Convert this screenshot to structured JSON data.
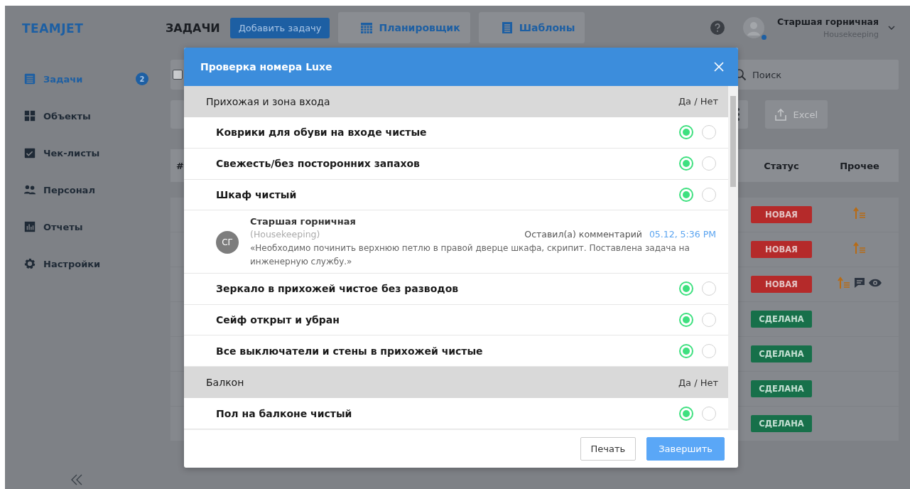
{
  "app": {
    "logo": "TEAMJET",
    "page_title": "ЗАДАЧИ",
    "actions": [
      {
        "label": "Добавить задачу",
        "kind": "primary"
      },
      {
        "label": "Планировщик",
        "kind": "planner"
      },
      {
        "label": "Шаблоны",
        "kind": "templates"
      }
    ],
    "user": {
      "name": "Старшая горничная",
      "role": "Housekeeping",
      "online": true
    }
  },
  "sidebar": {
    "items": [
      {
        "label": "Задачи",
        "selected": true,
        "badge": "2"
      },
      {
        "label": "Объекты",
        "selected": false
      },
      {
        "label": "Чек-листы",
        "selected": false
      },
      {
        "label": "Персонал",
        "selected": false
      },
      {
        "label": "Отчеты",
        "selected": false
      },
      {
        "label": "Настройки",
        "selected": false
      }
    ]
  },
  "toolbar": {
    "select_all": {
      "checked": false
    },
    "search": {
      "placeholder": "Поиск"
    },
    "export": {
      "label": "Excel",
      "disabled": true
    }
  },
  "table": {
    "columns": [
      "#",
      "Статус",
      "Прочее"
    ],
    "rows": [
      {
        "status": "НОВАЯ",
        "kind": "new",
        "priority": true,
        "commented": false,
        "viewed": false
      },
      {
        "status": "НОВАЯ",
        "kind": "new",
        "priority": true,
        "commented": false,
        "viewed": false
      },
      {
        "status": "НОВАЯ",
        "kind": "new",
        "priority": true,
        "commented": true,
        "viewed": true
      },
      {
        "status": "СДЕЛАНА",
        "kind": "done",
        "priority": false,
        "commented": false,
        "viewed": false
      },
      {
        "status": "СДЕЛАНА",
        "kind": "done",
        "priority": false,
        "commented": false,
        "viewed": false
      },
      {
        "status": "СДЕЛАНА",
        "kind": "done",
        "priority": false,
        "commented": false,
        "viewed": false
      },
      {
        "status": "СДЕЛАНА",
        "kind": "done",
        "priority": false,
        "commented": false,
        "viewed": false
      }
    ]
  },
  "modal": {
    "title": "Проверка номера Luxe",
    "sections": [
      {
        "title": "Прихожая и зона входа",
        "answer_header": "Да / Нет",
        "items": [
          {
            "kind": "check",
            "label": "Коврики для обуви на входе чистые",
            "yes": true,
            "no": false
          },
          {
            "kind": "check",
            "label": "Свежесть/без посторонних запахов",
            "yes": true,
            "no": false
          },
          {
            "kind": "check",
            "label": "Шкаф чистый",
            "yes": true,
            "no": false
          },
          {
            "kind": "comment",
            "author": "Старшая горничная",
            "role": "(Housekeeping)",
            "initials": "СГ",
            "action": "Оставил(а) комментарий",
            "time": "05.12, 5:36 PM",
            "text": "«Необходимо починить верхнюю петлю в правой дверце шкафа, скрипит. Поставлена задача на инженерную службу.»"
          },
          {
            "kind": "check",
            "label": "Зеркало в прихожей чистое без разводов",
            "yes": true,
            "no": false
          },
          {
            "kind": "check",
            "label": "Сейф открыт и убран",
            "yes": true,
            "no": false
          },
          {
            "kind": "check",
            "label": "Все выключатели и стены в прихожей чистые",
            "yes": true,
            "no": false
          }
        ]
      },
      {
        "title": "Балкон",
        "answer_header": "Да / Нет",
        "items": [
          {
            "kind": "check",
            "label": "Пол на балконе чистый",
            "yes": true,
            "no": false
          }
        ]
      }
    ],
    "buttons": [
      {
        "label": "Печать",
        "kind": "secondary"
      },
      {
        "label": "Завершить",
        "kind": "primary"
      }
    ]
  }
}
